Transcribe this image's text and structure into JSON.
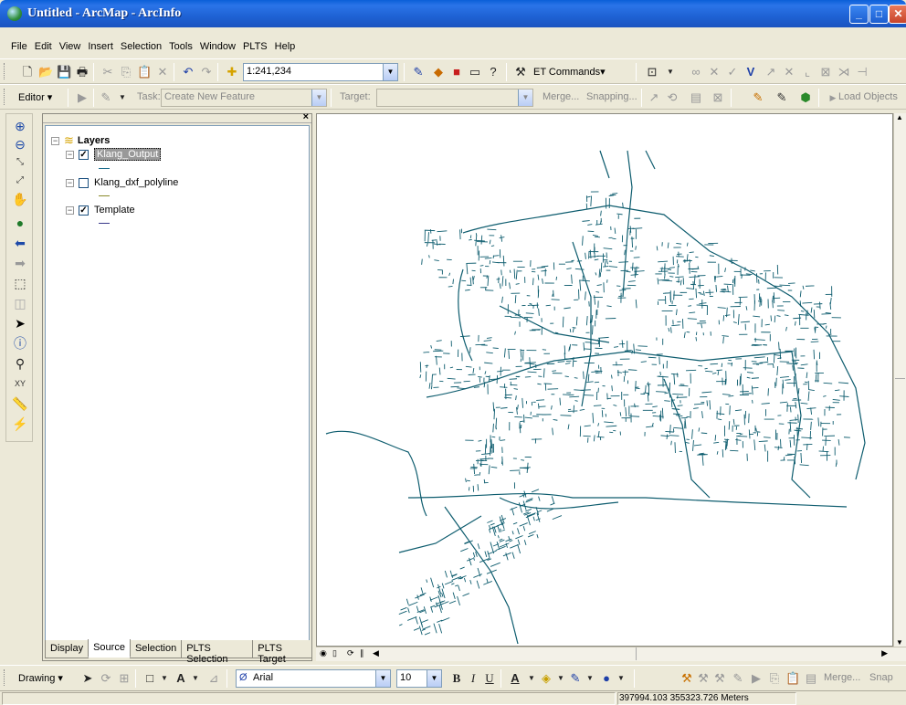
{
  "window": {
    "title": "Untitled - ArcMap - ArcInfo"
  },
  "menu": [
    "File",
    "Edit",
    "View",
    "Insert",
    "Selection",
    "Tools",
    "Window",
    "PLTS",
    "Help"
  ],
  "toolbar1": {
    "scale": "1:241,234",
    "et_commands": "ET Commands▾"
  },
  "toolbar2": {
    "editor": "Editor",
    "task_label": "Task:",
    "task_value": "Create New Feature",
    "target_label": "Target:",
    "target_value": "",
    "merge": "Merge...",
    "snapping": "Snapping...",
    "load_objects": "Load Objects"
  },
  "toc": {
    "root": "Layers",
    "layers": [
      {
        "name": "Klang_Output",
        "checked": true,
        "selected": true,
        "color": "#1a6b8a"
      },
      {
        "name": "Klang_dxf_polyline",
        "checked": false,
        "selected": false,
        "color": "#8a8a2a"
      },
      {
        "name": "Template",
        "checked": true,
        "selected": false,
        "color": "#3a3a8a"
      }
    ],
    "tabs": [
      "Display",
      "Source",
      "Selection",
      "PLTS Selection",
      "PLTS Target"
    ]
  },
  "drawing": {
    "label": "Drawing",
    "font": "Arial",
    "size": "10",
    "merge": "Merge...",
    "snap": "Snap"
  },
  "status": {
    "coords": "397994.103  355323.726 Meters"
  },
  "colors": {
    "map_lines": "#0d5c6e",
    "titlebar": "#1e62d4"
  }
}
